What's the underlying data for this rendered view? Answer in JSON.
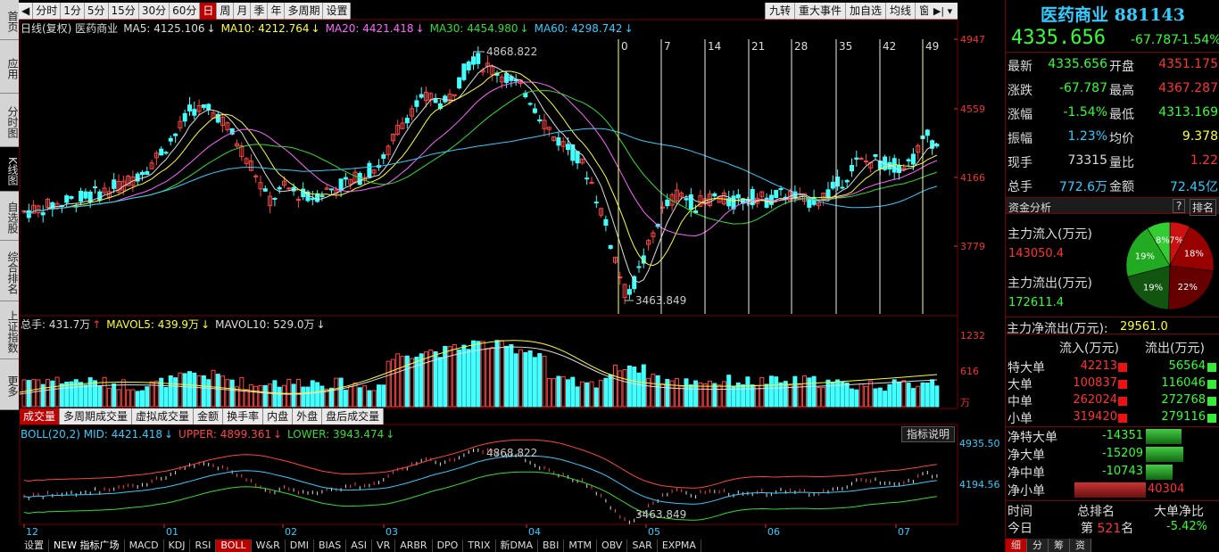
{
  "left_nav": [
    {
      "label": "首页"
    },
    {
      "label": "应用"
    },
    {
      "label": "分时图"
    },
    {
      "label": "K线图"
    },
    {
      "label": "自选股"
    },
    {
      "label": "综合排名"
    },
    {
      "label": "上证指数"
    },
    {
      "label": "更多"
    }
  ],
  "toolbar": {
    "periods": [
      "分时",
      "1分",
      "5分",
      "15分",
      "30分",
      "60分",
      "日",
      "周",
      "月",
      "季",
      "年",
      "多周期",
      "设置"
    ],
    "active": "日",
    "right": [
      "九转",
      "重大事件",
      "加自选",
      "均线",
      "窗"
    ]
  },
  "kline": {
    "legend": [
      {
        "text": "日线(复权) 医药商业",
        "color": "#dddddd"
      },
      {
        "text": "MA5: 4125.106",
        "color": "#dddddd"
      },
      {
        "text": "MA10: 4212.764",
        "color": "#ffff33"
      },
      {
        "text": "MA20: 4421.418",
        "color": "#ff66ff"
      },
      {
        "text": "MA30: 4454.980",
        "color": "#33dd33"
      },
      {
        "text": "MA60: 4298.742",
        "color": "#33ccff"
      }
    ],
    "y_axis": [
      "4947",
      "4559",
      "4166",
      "3779"
    ],
    "high_label": "4868.822",
    "low_label": "3463.849",
    "nine_labels": [
      "0",
      "7",
      "14",
      "21",
      "28",
      "35",
      "42",
      "49"
    ]
  },
  "volume": {
    "legend": [
      {
        "text": "总手: 431.7万",
        "color": "#dddddd"
      },
      {
        "text": "MAVOL5: 439.9万",
        "color": "#ffff33"
      },
      {
        "text": "MAVOL10: 529.0万",
        "color": "#dddddd"
      }
    ],
    "y_axis": [
      "1232",
      "616",
      "万"
    ]
  },
  "sub_tabs": [
    "成交量",
    "多周期成交量",
    "虚拟成交量",
    "金额",
    "换手率",
    "内盘",
    "外盘",
    "盘后成交量"
  ],
  "boll": {
    "legend": [
      {
        "text": "BOLL(20,2) MID: 4421.418",
        "color": "#33ccff"
      },
      {
        "text": "UPPER: 4899.361",
        "color": "#ff4444"
      },
      {
        "text": "LOWER: 3943.474",
        "color": "#33dd33"
      }
    ],
    "y_axis": [
      "4935.50",
      "4194.56"
    ],
    "btn": "指标说明",
    "high_label": "4868.822",
    "low_label": "3463.849"
  },
  "x_axis": [
    "12",
    "01",
    "02",
    "03",
    "04",
    "05",
    "06",
    "07"
  ],
  "bottom_tabs": [
    "设置",
    "NEW 指标广场",
    "MACD",
    "KDJ",
    "RSI",
    "BOLL",
    "W&R",
    "DMI",
    "BIAS",
    "ASI",
    "VR",
    "ARBR",
    "DPO",
    "TRIX",
    "新DMA",
    "BBI",
    "MTM",
    "OBV",
    "SAR",
    "EXPMA"
  ],
  "stock": {
    "name": "医药商业",
    "code": "881143",
    "price": "4335.656",
    "change": "-67.787",
    "pct": "-1.54%"
  },
  "quote": [
    {
      "l": "最新",
      "v": "4335.656",
      "l2": "开盘",
      "v2": "4351.175",
      "c": "g",
      "c2": "r"
    },
    {
      "l": "涨跌",
      "v": "-67.787",
      "l2": "最高",
      "v2": "4367.287",
      "c": "g",
      "c2": "r"
    },
    {
      "l": "涨幅",
      "v": "-1.54%",
      "l2": "最低",
      "v2": "4313.169",
      "c": "g",
      "c2": "g"
    },
    {
      "l": "振幅",
      "v": "1.23%",
      "l2": "均价",
      "v2": "9.378",
      "c": "c",
      "c2": "y"
    },
    {
      "l": "现手",
      "v": "73315",
      "l2": "量比",
      "v2": "1.22",
      "c": "w",
      "c2": "r"
    },
    {
      "l": "总手",
      "v": "772.6万",
      "l2": "金额",
      "v2": "72.45亿",
      "c": "c",
      "c2": "c"
    }
  ],
  "fund": {
    "title": "资金分析",
    "q": "?",
    "btn": "排名",
    "in_label": "主力流入(万元)",
    "in_val": "143050.4",
    "out_label": "主力流出(万元)",
    "out_val": "172611.4",
    "net_label": "主力净流出(万元):",
    "net_val": "29561.0",
    "pie": [
      {
        "pct": "7%",
        "color": "#cc1111",
        "value": 7
      },
      {
        "pct": "18%",
        "color": "#990000",
        "value": 18
      },
      {
        "pct": "22%",
        "color": "#660000",
        "value": 22
      },
      {
        "pct": "19%",
        "color": "#115511",
        "value": 19
      },
      {
        "pct": "19%",
        "color": "#22aa22",
        "value": 19
      },
      {
        "pct": "8%",
        "color": "#33cc33",
        "value": 8
      }
    ]
  },
  "flow": {
    "h_in": "流入(万元)",
    "h_out": "流出(万元)",
    "rows": [
      {
        "l": "特大单",
        "in": "42213",
        "out": "56564"
      },
      {
        "l": "大单",
        "in": "100837",
        "out": "116046"
      },
      {
        "l": "中单",
        "in": "262024",
        "out": "272768"
      },
      {
        "l": "小单",
        "in": "319420",
        "out": "279116"
      }
    ]
  },
  "net": [
    {
      "l": "净特大单",
      "v": "-14351",
      "neg": true,
      "mag": 14351
    },
    {
      "l": "净大单",
      "v": "-15209",
      "neg": true,
      "mag": 15209
    },
    {
      "l": "净中单",
      "v": "-10743",
      "neg": true,
      "mag": 10743
    },
    {
      "l": "净小单",
      "v": "40304",
      "neg": false,
      "mag": 40304
    }
  ],
  "rank": {
    "h1": "时间",
    "h2": "总排名",
    "h3": "大单净比",
    "today": "今日",
    "rank_prefix": "第",
    "rank": "521",
    "rank_suffix": "名",
    "ratio": "-5.42%"
  },
  "rtabs": [
    "细",
    "分",
    "筹",
    "资"
  ]
}
